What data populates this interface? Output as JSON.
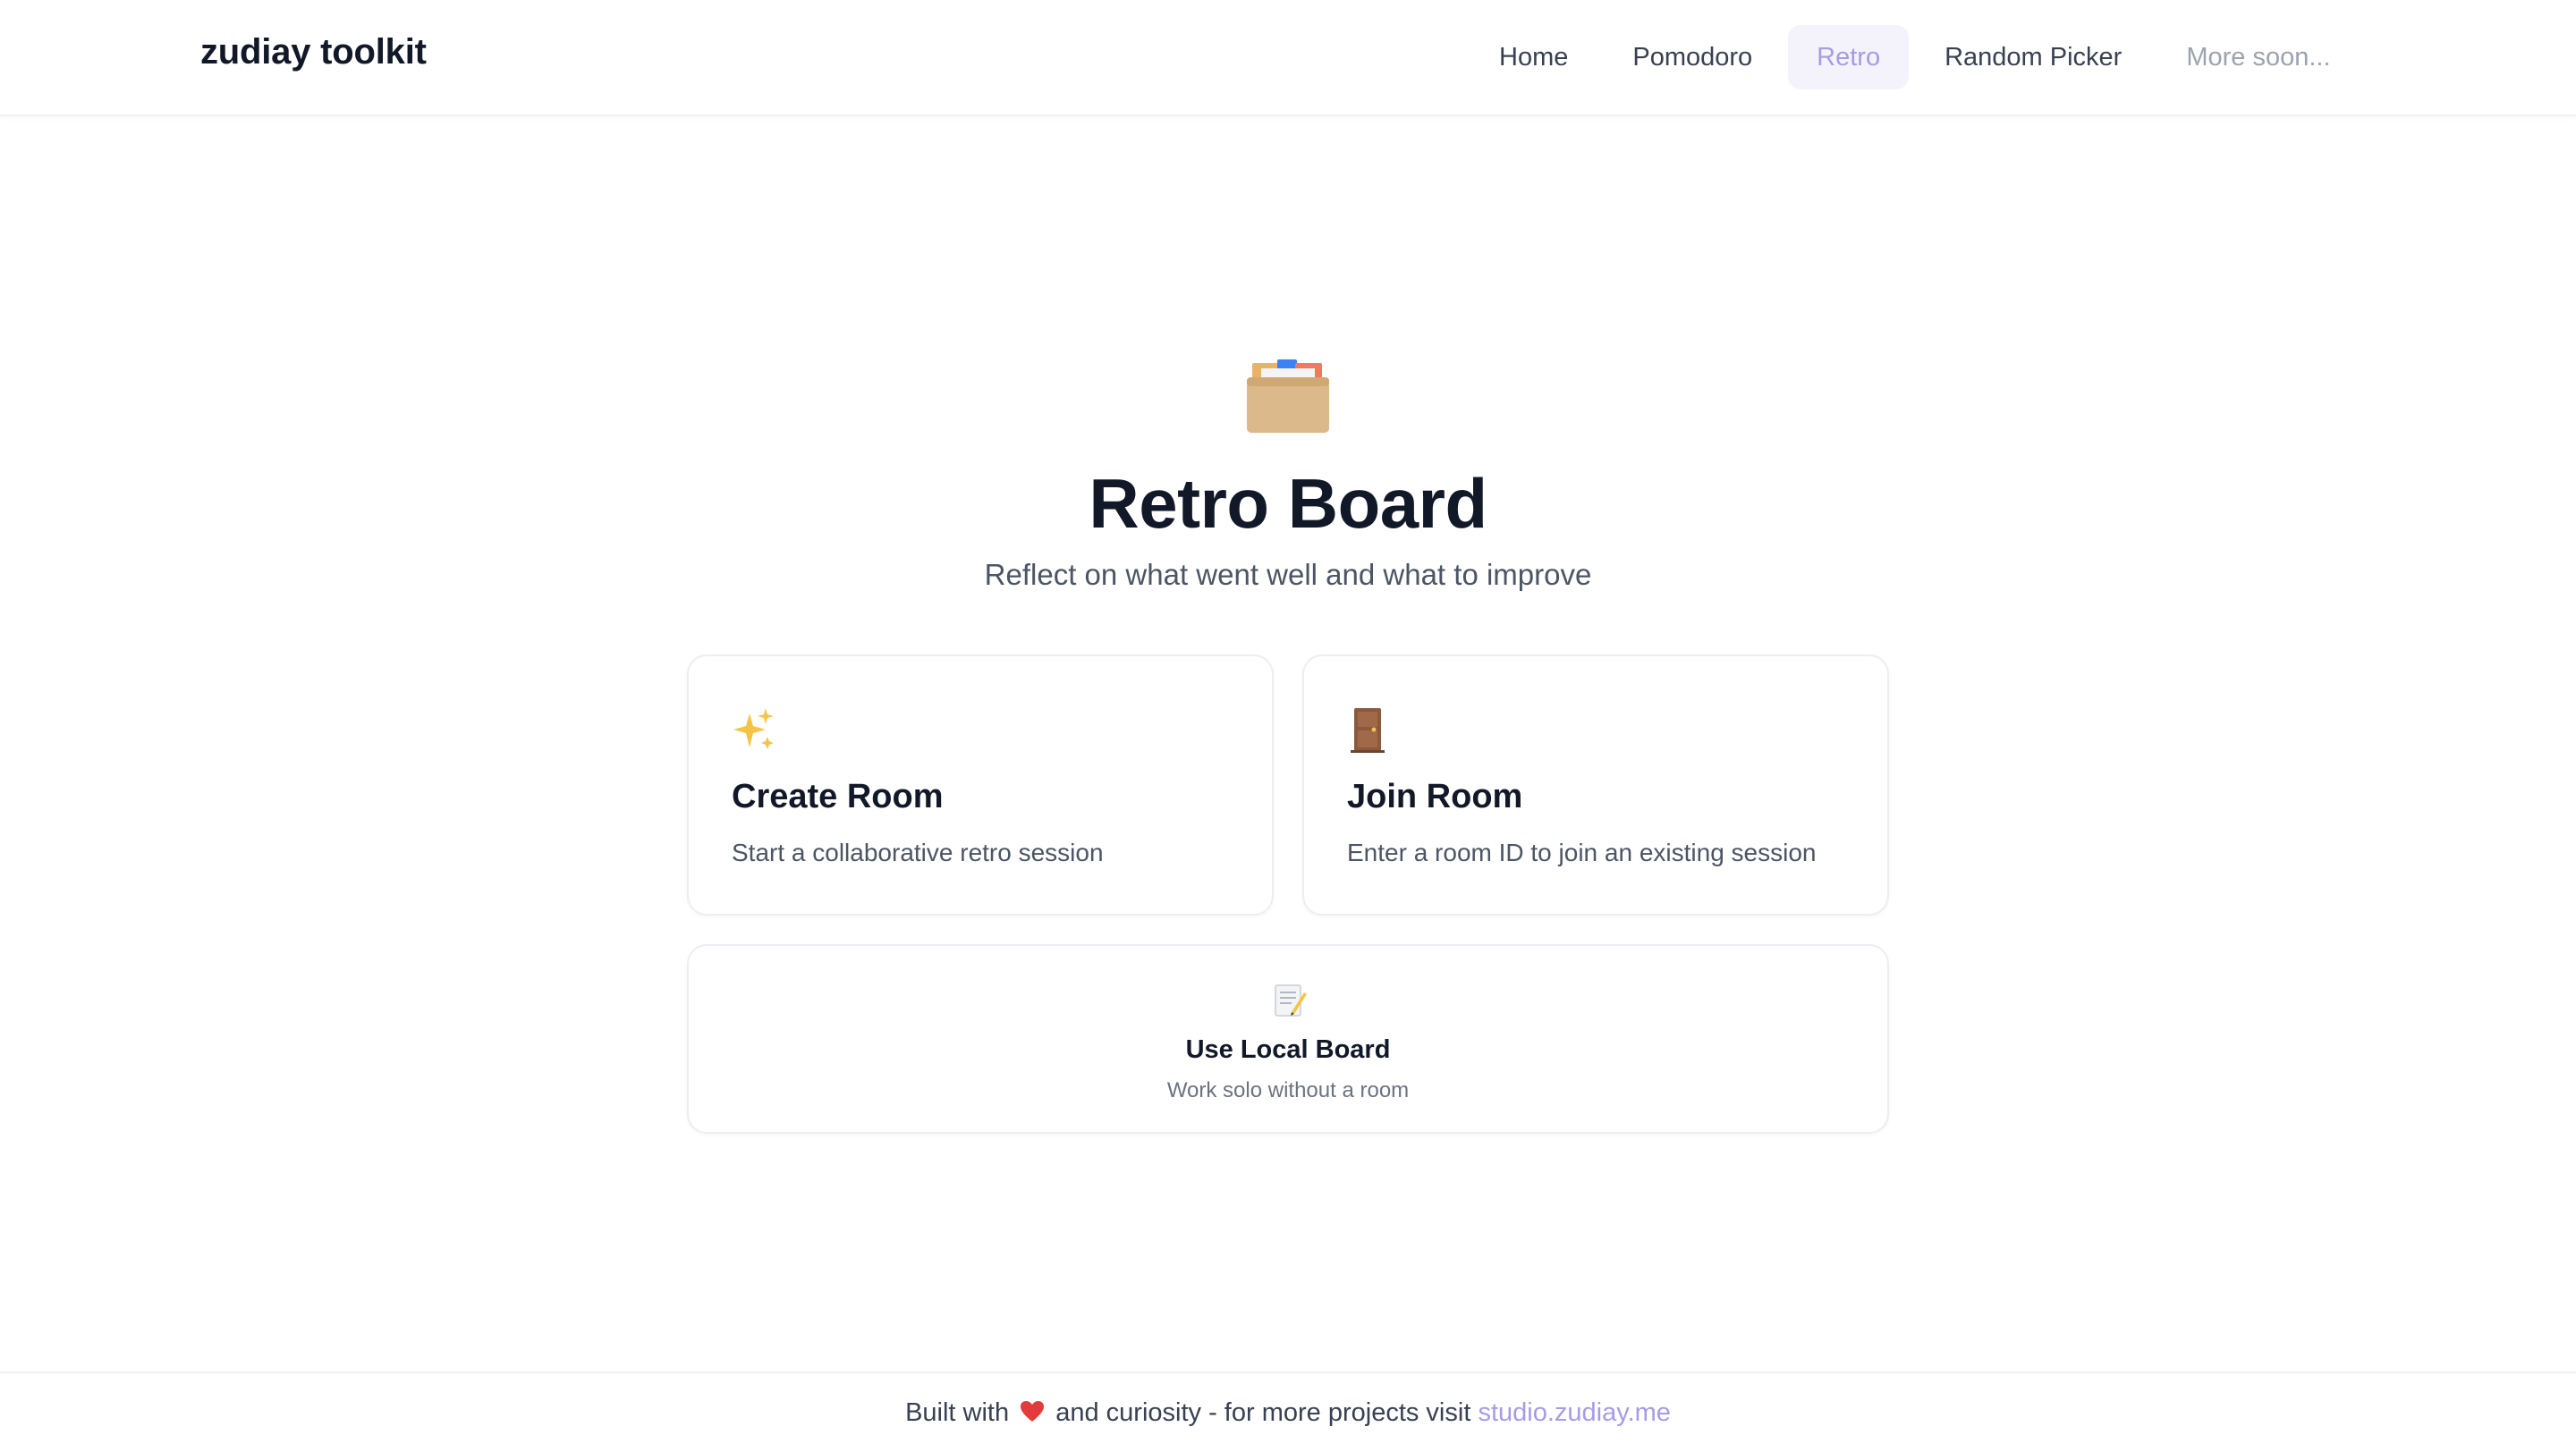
{
  "header": {
    "brand": "zudiay toolkit",
    "nav": [
      {
        "label": "Home"
      },
      {
        "label": "Pomodoro"
      },
      {
        "label": "Retro",
        "active": true
      },
      {
        "label": "Random Picker"
      },
      {
        "label": "More soon..."
      }
    ]
  },
  "hero": {
    "icon": "card-file-box-icon",
    "title": "Retro Board",
    "subtitle": "Reflect on what went well and what to improve"
  },
  "cards": {
    "create": {
      "icon": "sparkles-icon",
      "title": "Create Room",
      "description": "Start a collaborative retro session"
    },
    "join": {
      "icon": "door-icon",
      "title": "Join Room",
      "description": "Enter a room ID to join an existing session"
    },
    "local": {
      "icon": "memo-icon",
      "title": "Use Local Board",
      "description": "Work solo without a room"
    }
  },
  "footer": {
    "prefix": "Built with",
    "heart_icon": "heart-icon",
    "middle": "and curiosity - for more projects visit",
    "link": "studio.zudiay.me"
  },
  "colors": {
    "accent": "#a79be6",
    "active_nav_bg": "#f4f3fc",
    "text_primary": "#111827",
    "text_secondary": "#4b5563"
  }
}
